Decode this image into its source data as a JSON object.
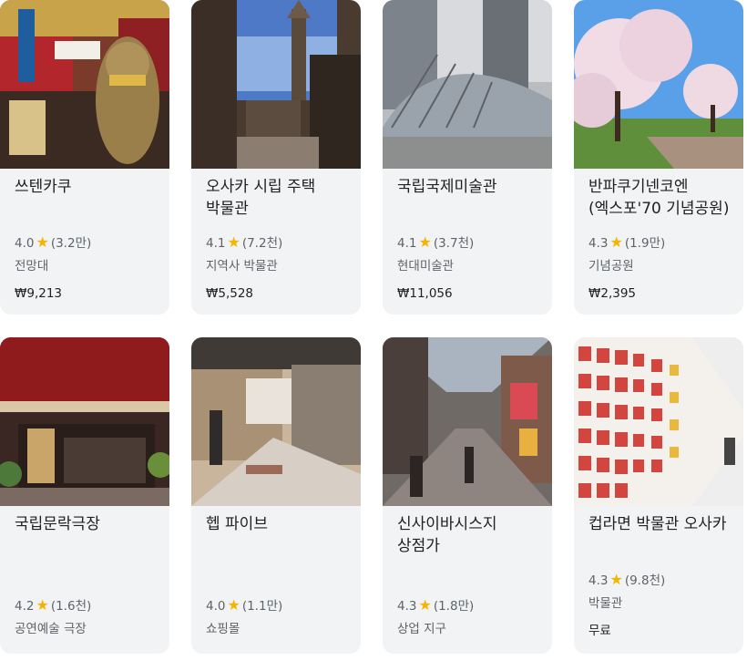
{
  "places": [
    {
      "title": "쓰텐카쿠",
      "rating": "4.0",
      "reviews": "(3.2만)",
      "category": "전망대",
      "price": "₩9,213"
    },
    {
      "title": "오사카 시립 주택 박물관",
      "rating": "4.1",
      "reviews": "(7.2천)",
      "category": "지역사 박물관",
      "price": "₩5,528"
    },
    {
      "title": "국립국제미술관",
      "rating": "4.1",
      "reviews": "(3.7천)",
      "category": "현대미술관",
      "price": "₩11,056"
    },
    {
      "title": "반파쿠기넨코엔 (엑스포'70 기념공원)",
      "rating": "4.3",
      "reviews": "(1.9만)",
      "category": "기념공원",
      "price": "₩2,395"
    },
    {
      "title": "국립문락극장",
      "rating": "4.2",
      "reviews": "(1.6천)",
      "category": "공연예술 극장",
      "price": ""
    },
    {
      "title": "헵 파이브",
      "rating": "4.0",
      "reviews": "(1.1만)",
      "category": "쇼핑몰",
      "price": ""
    },
    {
      "title": "신사이바시스지 상점가",
      "rating": "4.3",
      "reviews": "(1.8만)",
      "category": "상업 지구",
      "price": ""
    },
    {
      "title": "컵라면 박물관 오사카",
      "rating": "4.3",
      "reviews": "(9.8천)",
      "category": "박물관",
      "price": "무료"
    }
  ],
  "star_glyph": "★",
  "colors": {
    "card_bg": "#f1f3f4",
    "star": "#f4b400",
    "muted_text": "#5f6368"
  }
}
